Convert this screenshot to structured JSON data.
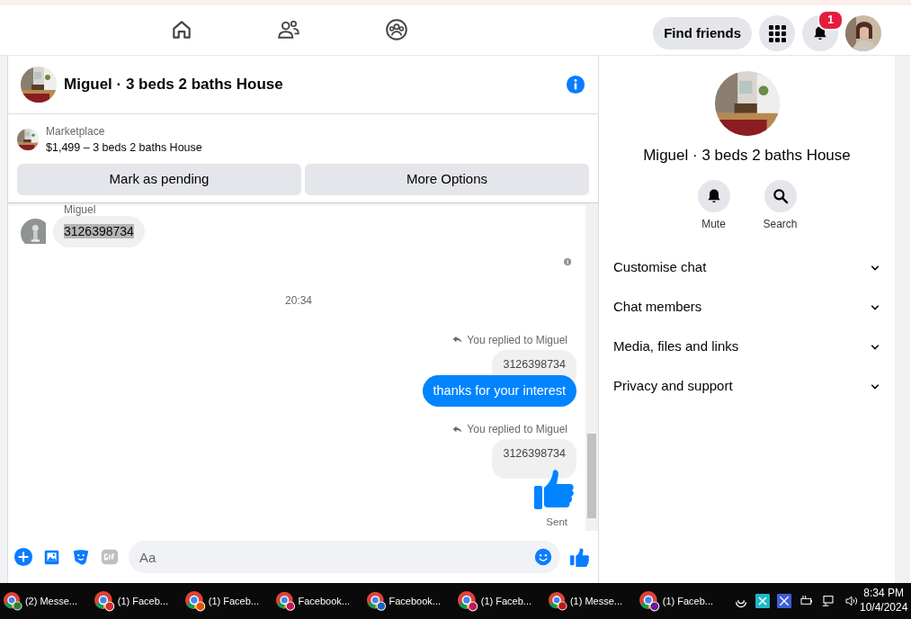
{
  "top_bar": {
    "nav_icons": [
      {
        "kind": "home"
      },
      {
        "kind": "friends"
      },
      {
        "kind": "groups"
      }
    ],
    "find_friends": "Find friends",
    "notification_count": "1"
  },
  "chat": {
    "title": "Miguel · 3 beds 2 baths House",
    "marketplace_label": "Marketplace",
    "listing": "$1,499 – 3 beds 2 baths House",
    "buttons": [
      "Mark as pending",
      "More Options"
    ],
    "messages": [
      {
        "kind": "sender",
        "text": "Miguel"
      },
      {
        "kind": "incoming",
        "text": "3126398734",
        "highlighted": true
      },
      {
        "kind": "seen"
      },
      {
        "kind": "time",
        "text": "20:34"
      },
      {
        "kind": "reply_note",
        "text": "You replied to Miguel"
      },
      {
        "kind": "quote",
        "text": "3126398734"
      },
      {
        "kind": "outgoing",
        "text": "thanks for your interest"
      },
      {
        "kind": "reply_note",
        "text": "You replied to Miguel"
      },
      {
        "kind": "quote",
        "text": "3126398734"
      },
      {
        "kind": "like"
      },
      {
        "kind": "status",
        "text": "Sent"
      }
    ],
    "composer": {
      "placeholder": "Aa"
    }
  },
  "details": {
    "name": "Miguel · 3 beds 2 baths House",
    "actions": [
      {
        "kind": "bell",
        "label": "Mute"
      },
      {
        "kind": "search",
        "label": "Search"
      }
    ],
    "sections": [
      {
        "label": "Customise chat",
        "expanded": false
      },
      {
        "label": "Chat members",
        "expanded": false
      },
      {
        "label": "Media, files and links",
        "expanded": false
      },
      {
        "label": "Privacy and support",
        "expanded": false
      }
    ]
  },
  "taskbar": {
    "items": [
      {
        "label": "(2) Messe...",
        "color": "#2e7d32"
      },
      {
        "label": "(1) Faceb...",
        "color": "#d32f2f"
      },
      {
        "label": "(1) Faceb...",
        "color": "#e65100"
      },
      {
        "label": "Facebook...",
        "color": "#c2185b"
      },
      {
        "label": "Facebook...",
        "color": "#1565c0"
      },
      {
        "label": "(1) Faceb...",
        "color": "#c2185b"
      },
      {
        "label": "(1) Messe...",
        "color": "#b71c1c"
      },
      {
        "label": "(1) Faceb...",
        "color": "#6a1b9a"
      }
    ],
    "time": "8:34 PM",
    "date": "10/4/2024"
  }
}
